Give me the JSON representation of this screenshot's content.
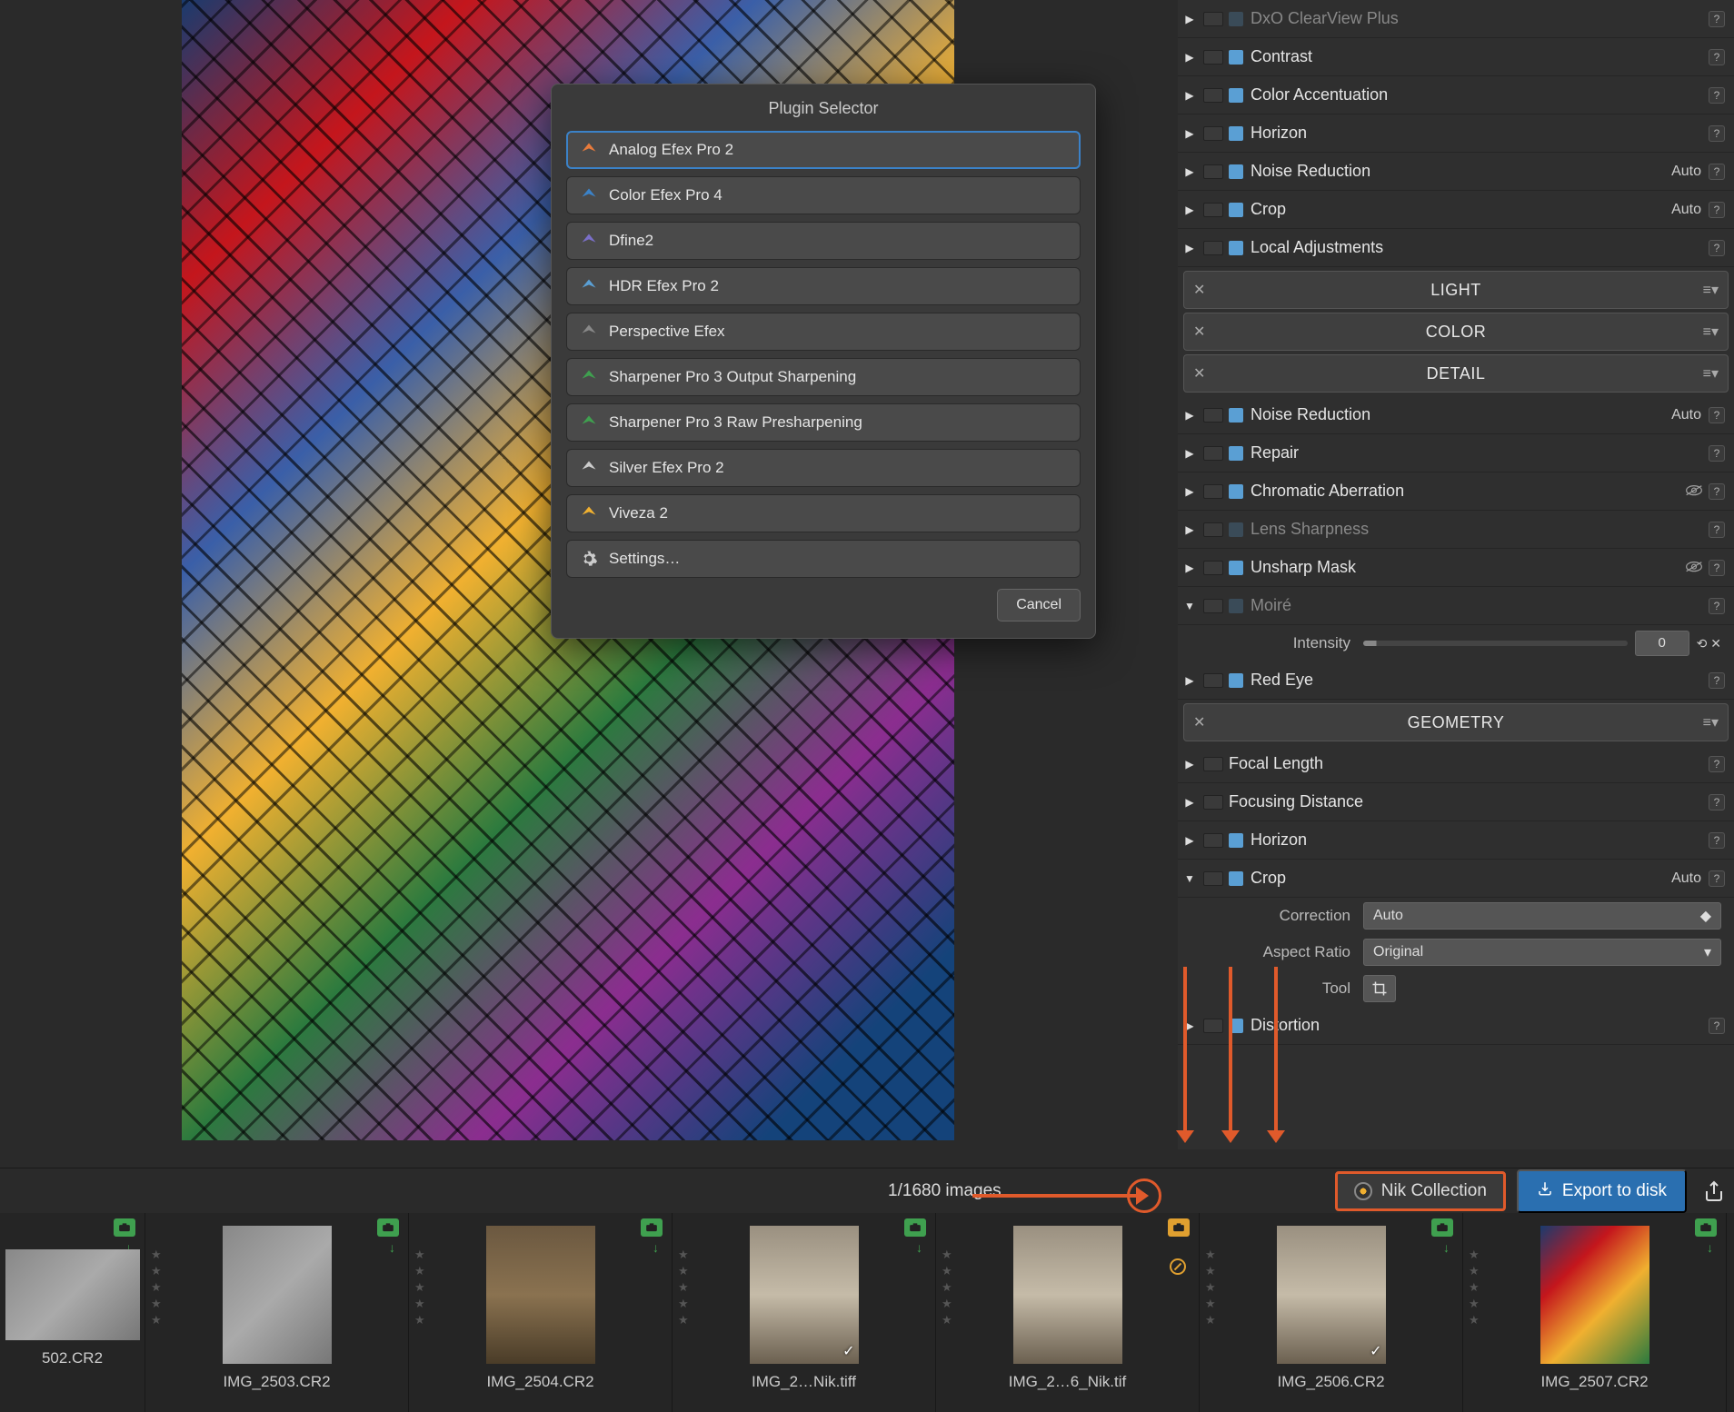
{
  "dialog": {
    "title": "Plugin Selector",
    "items": [
      {
        "name": "Analog Efex Pro 2",
        "selected": true
      },
      {
        "name": "Color Efex Pro 4"
      },
      {
        "name": "Dfine2"
      },
      {
        "name": "HDR Efex Pro 2"
      },
      {
        "name": "Perspective Efex"
      },
      {
        "name": "Sharpener Pro 3 Output Sharpening"
      },
      {
        "name": "Sharpener Pro 3 Raw Presharpening"
      },
      {
        "name": "Silver Efex Pro 2"
      },
      {
        "name": "Viveza 2"
      },
      {
        "name": "Settings…"
      }
    ],
    "cancel": "Cancel"
  },
  "panel": {
    "topRows": [
      {
        "label": "DxO ClearView Plus",
        "dim": true
      },
      {
        "label": "Contrast"
      },
      {
        "label": "Color Accentuation"
      },
      {
        "label": "Horizon"
      },
      {
        "label": "Noise Reduction",
        "auto": "Auto"
      },
      {
        "label": "Crop",
        "auto": "Auto"
      },
      {
        "label": "Local Adjustments"
      }
    ],
    "sections": {
      "light": "LIGHT",
      "color": "COLOR",
      "detail": "DETAIL",
      "geometry": "GEOMETRY"
    },
    "detailRows": [
      {
        "label": "Noise Reduction",
        "auto": "Auto"
      },
      {
        "label": "Repair"
      },
      {
        "label": "Chromatic Aberration",
        "eye": true
      },
      {
        "label": "Lens Sharpness",
        "dim": true
      },
      {
        "label": "Unsharp Mask",
        "eye": true
      },
      {
        "label": "Moiré",
        "expanded": true,
        "dim": true
      },
      {
        "label": "Red Eye"
      }
    ],
    "moire": {
      "label": "Intensity",
      "value": "0"
    },
    "geometryRows": [
      {
        "label": "Focal Length"
      },
      {
        "label": "Focusing Distance"
      },
      {
        "label": "Horizon"
      },
      {
        "label": "Crop",
        "auto": "Auto",
        "expanded": true
      },
      {
        "label": "Distortion"
      }
    ],
    "crop": {
      "correction_label": "Correction",
      "correction_value": "Auto",
      "aspect_label": "Aspect Ratio",
      "aspect_value": "Original",
      "tool_label": "Tool"
    }
  },
  "bottomBar": {
    "counter": "1/1680 images",
    "nik": "Nik Collection",
    "export": "Export to disk"
  },
  "filmstrip": [
    {
      "name": "502.CR2",
      "badge": "green",
      "style": "parking",
      "wide": true
    },
    {
      "name": "IMG_2503.CR2",
      "badge": "green",
      "style": "parking"
    },
    {
      "name": "IMG_2504.CR2",
      "badge": "green",
      "style": "church"
    },
    {
      "name": "IMG_2…Nik.tiff",
      "badge": "green",
      "style": "gothic",
      "check": true
    },
    {
      "name": "IMG_2…6_Nik.tif",
      "badge": "orange",
      "style": "gothic",
      "noentry": true
    },
    {
      "name": "IMG_2506.CR2",
      "badge": "green",
      "style": "gothic",
      "check": true
    },
    {
      "name": "IMG_2507.CR2",
      "badge": "green",
      "style": "glass"
    }
  ]
}
